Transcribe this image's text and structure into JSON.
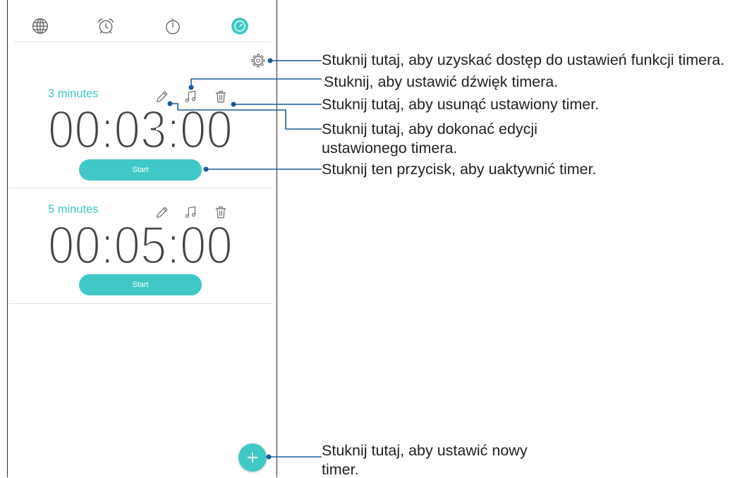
{
  "colors": {
    "accent": "#3fc8c6",
    "callout": "#1c5b98",
    "icon": "#5a5a5a",
    "digits": "#444444",
    "note": "#231f20"
  },
  "tabs": [
    {
      "icon": "globe-icon",
      "active": false
    },
    {
      "icon": "alarm-clock-icon",
      "active": false
    },
    {
      "icon": "stopwatch-icon",
      "active": false
    },
    {
      "icon": "timer-icon",
      "active": true
    }
  ],
  "settings_icon": "gear-icon",
  "timers": [
    {
      "label": "3 minutes",
      "time": "00:03:00",
      "start_label": "Start",
      "icons": [
        "pencil-icon",
        "music-note-icon",
        "trash-icon"
      ]
    },
    {
      "label": "5 minutes",
      "time": "00:05:00",
      "start_label": "Start",
      "icons": [
        "pencil-icon",
        "music-note-icon",
        "trash-icon"
      ]
    }
  ],
  "fab_icon": "plus-icon",
  "callouts": {
    "settings": "Stuknij tutaj, aby uzyskać dostęp do ustawień funkcji timera.",
    "sound": "Stuknij, aby ustawić dźwięk timera.",
    "delete": "Stuknij tutaj, aby usunąć ustawiony timer.",
    "edit": [
      "Stuknij tutaj, aby dokonać edycji",
      "ustawionego timera."
    ],
    "start": "Stuknij ten przycisk, aby uaktywnić timer.",
    "add": [
      "Stuknij tutaj, aby ustawić nowy",
      "timer."
    ]
  }
}
